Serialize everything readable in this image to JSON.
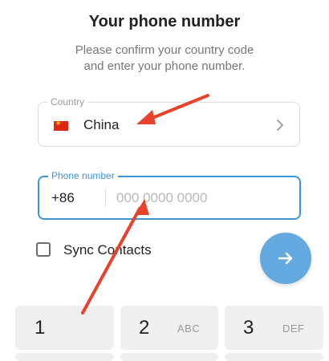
{
  "header": {
    "title": "Your phone number",
    "subtitle_line1": "Please confirm your country code",
    "subtitle_line2": "and enter your phone number."
  },
  "country": {
    "label": "Country",
    "name": "China",
    "flag_icon": "china-flag-icon"
  },
  "phone": {
    "label": "Phone number",
    "code": "+86",
    "value": "",
    "placeholder": "000 0000 0000"
  },
  "sync": {
    "label": "Sync Contacts",
    "checked": false
  },
  "keypad": [
    {
      "digit": "1",
      "letters": ""
    },
    {
      "digit": "2",
      "letters": "ABC"
    },
    {
      "digit": "3",
      "letters": "DEF"
    }
  ],
  "colors": {
    "accent": "#3d95d6",
    "fab": "#64a9e0",
    "annotation": "#e8412c",
    "key_bg": "#efefef"
  }
}
